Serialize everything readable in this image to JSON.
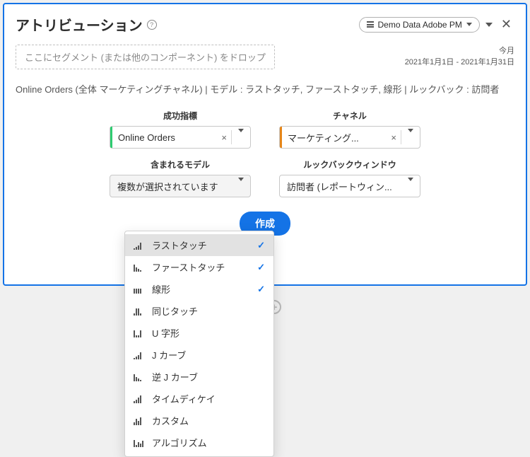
{
  "header": {
    "title": "アトリビューション",
    "dataset_label": "Demo Data Adobe PM"
  },
  "dropzone": {
    "placeholder": "ここにセグメント (または他のコンポーネント) をドロップ"
  },
  "daterange": {
    "label": "今月",
    "range": "2021年1月1日 - 2021年1月31日"
  },
  "summary": "Online Orders (全体 マーケティングチャネル) | モデル : ラストタッチ, ファーストタッチ, 線形 | ルックバック : 訪問者",
  "controls": {
    "metric": {
      "label": "成功指標",
      "value": "Online Orders"
    },
    "channel": {
      "label": "チャネル",
      "value": "マーケティング..."
    },
    "model": {
      "label": "含まれるモデル",
      "value": "複数が選択されています"
    },
    "lookback": {
      "label": "ルックバックウィンドウ",
      "value": "訪問者 (レポートウィン..."
    }
  },
  "create_label": "作成",
  "model_menu": {
    "items": [
      {
        "label": "ラストタッチ",
        "selected": true
      },
      {
        "label": "ファーストタッチ",
        "selected": true
      },
      {
        "label": "線形",
        "selected": true
      },
      {
        "label": "同じタッチ",
        "selected": false
      },
      {
        "label": "U 字形",
        "selected": false
      },
      {
        "label": "J カーブ",
        "selected": false
      },
      {
        "label": "逆 J カーブ",
        "selected": false
      },
      {
        "label": "タイムディケイ",
        "selected": false
      },
      {
        "label": "カスタム",
        "selected": false
      },
      {
        "label": "アルゴリズム",
        "selected": false
      }
    ]
  }
}
